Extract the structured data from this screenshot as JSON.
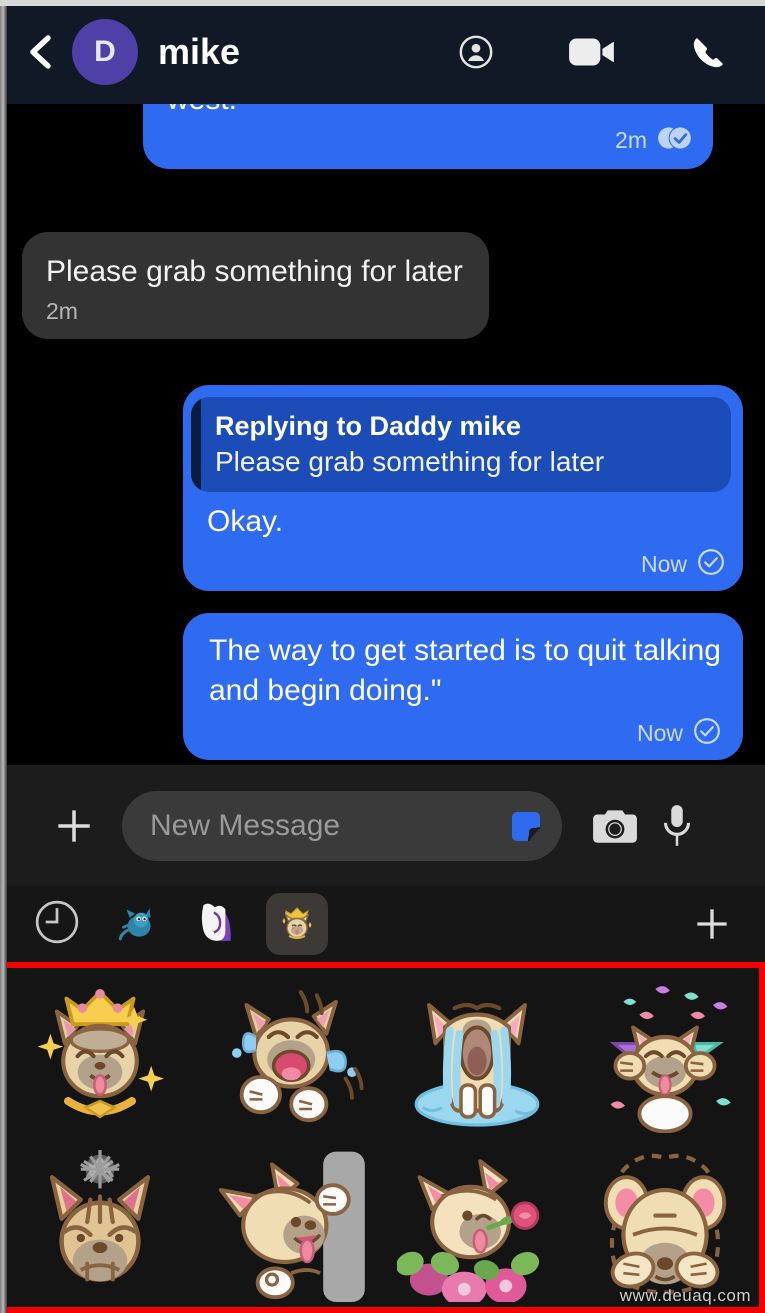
{
  "header": {
    "back_icon": "chevron-left-icon",
    "avatar_initial": "D",
    "avatar_color": "#4f40a8",
    "title": "mike",
    "icons": [
      "profile-circle-icon",
      "video-camera-icon",
      "phone-icon"
    ],
    "background": "#111826"
  },
  "conversation": {
    "background": "#000000",
    "outgoing_color": "#2f6bf0",
    "incoming_color": "#333333",
    "messages": [
      {
        "id": "msg-clipped-west",
        "direction": "out",
        "text": "west.",
        "time": "2m",
        "status_icon": "double-circle-check-icon",
        "clipped": true
      },
      {
        "id": "msg-grab-something",
        "direction": "in",
        "text": "Please grab something for later",
        "time": "2m",
        "status_icon": ""
      },
      {
        "id": "msg-okay-reply",
        "direction": "out",
        "text": "Okay.",
        "time": "Now",
        "status_icon": "circle-check-icon",
        "reply": {
          "title": "Replying to Daddy mike",
          "text": "Please grab something for later"
        }
      },
      {
        "id": "msg-quote",
        "direction": "out",
        "text": "The way to get started is to quit talking and begin doing.\"",
        "time": "Now",
        "status_icon": "circle-check-icon"
      }
    ]
  },
  "composer": {
    "background": "#1c1c1c",
    "plus_icon": "plus-icon",
    "input_placeholder": "New Message",
    "input_value": "",
    "sticker_icon": "sticker-icon",
    "camera_icon": "camera-icon",
    "microphone_icon": "microphone-icon"
  },
  "sticker_tabs": {
    "background": "#161616",
    "items": [
      {
        "id": "tab-recent",
        "icon": "clock-icon",
        "selected": false
      },
      {
        "id": "tab-blue-cat",
        "icon": "blue-cat-sticker-icon",
        "selected": false
      },
      {
        "id": "tab-white-hand",
        "icon": "white-hand-sticker-icon",
        "selected": false
      },
      {
        "id": "tab-crown-pug",
        "icon": "crown-pug-sticker-icon",
        "selected": true
      }
    ],
    "add_icon": "plus-icon"
  },
  "sticker_grid": {
    "border_color": "#f40000",
    "background": "#141414",
    "stickers": [
      {
        "id": "sticker-king-pug",
        "name": "king-pug-with-crown-sticker"
      },
      {
        "id": "sticker-laughing-crying-pug",
        "name": "laughing-crying-pug-sticker"
      },
      {
        "id": "sticker-sobbing-pug",
        "name": "sobbing-pug-in-puddle-sticker"
      },
      {
        "id": "sticker-confetti-pug",
        "name": "celebrating-confetti-pug-sticker"
      },
      {
        "id": "sticker-angry-pug",
        "name": "angry-pug-with-scribble-sticker"
      },
      {
        "id": "sticker-peeking-pug",
        "name": "peeking-around-wall-pug-sticker"
      },
      {
        "id": "sticker-flower-pug",
        "name": "pug-with-rose-and-flowers-sticker"
      },
      {
        "id": "sticker-shy-pug",
        "name": "shy-covering-face-pug-sticker"
      }
    ]
  },
  "watermark": "www.deuaq.com"
}
